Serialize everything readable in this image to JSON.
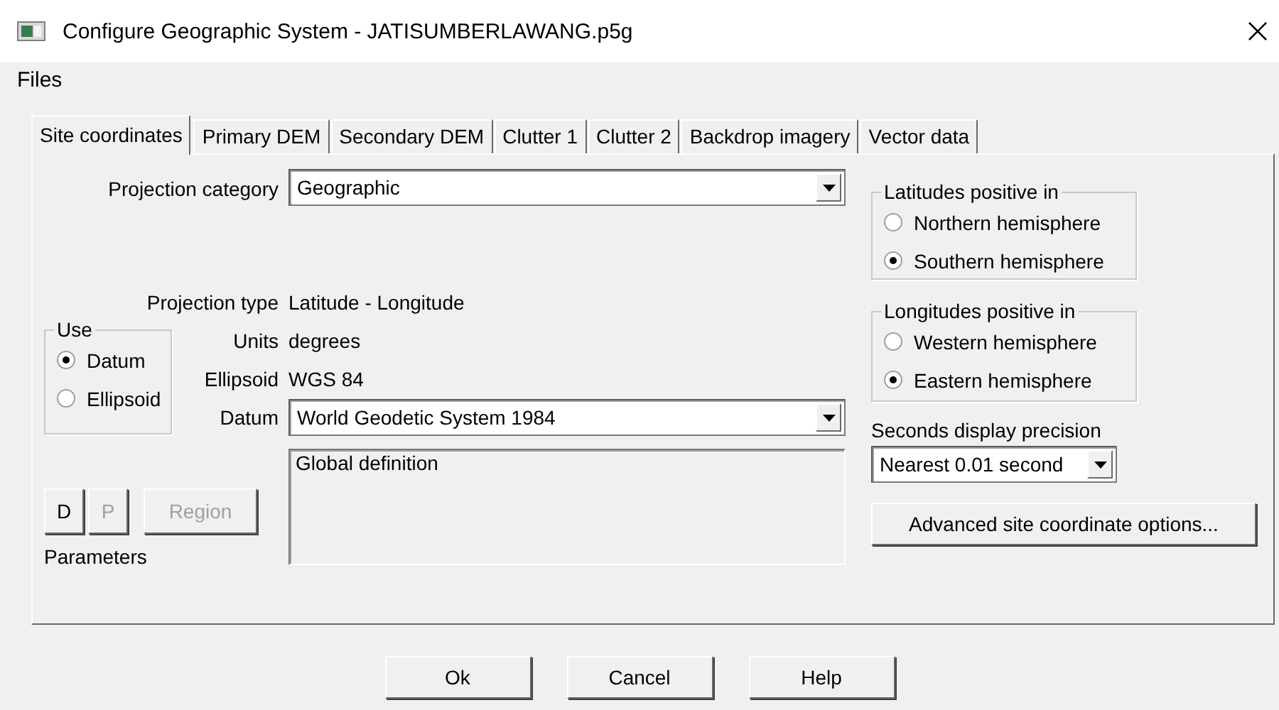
{
  "window": {
    "title": "Configure Geographic System - JATISUMBERLAWANG.p5g"
  },
  "menu": [
    "Files"
  ],
  "tabs": [
    {
      "label": "Site coordinates",
      "selected": true
    },
    {
      "label": "Primary DEM",
      "selected": false
    },
    {
      "label": "Secondary DEM",
      "selected": false
    },
    {
      "label": "Clutter 1",
      "selected": false
    },
    {
      "label": "Clutter 2",
      "selected": false
    },
    {
      "label": "Backdrop imagery",
      "selected": false
    },
    {
      "label": "Vector data",
      "selected": false
    }
  ],
  "site": {
    "projection_category": {
      "label": "Projection category",
      "value": "Geographic"
    },
    "info": [
      {
        "label": "Projection type",
        "value": "Latitude - Longitude"
      },
      {
        "label": "Units",
        "value": "degrees"
      },
      {
        "label": "Ellipsoid",
        "value": "WGS 84"
      }
    ],
    "use": {
      "title": "Use",
      "options": [
        {
          "label": "Datum",
          "selected": true
        },
        {
          "label": "Ellipsoid",
          "selected": false
        }
      ]
    },
    "datum": {
      "label": "Datum",
      "value": "World Geodetic System 1984"
    },
    "definition": "Global definition",
    "parameter_buttons": [
      {
        "label": "D",
        "disabled": false
      },
      {
        "label": "P",
        "disabled": true
      },
      {
        "label": "Region",
        "disabled": true
      }
    ],
    "parameters_label": "Parameters",
    "latitudes": {
      "title": "Latitudes positive in",
      "options": [
        {
          "label": "Northern hemisphere",
          "selected": false
        },
        {
          "label": "Southern hemisphere",
          "selected": true
        }
      ]
    },
    "longitudes": {
      "title": "Longitudes positive in",
      "options": [
        {
          "label": "Western hemisphere",
          "selected": false
        },
        {
          "label": "Eastern hemisphere",
          "selected": true
        }
      ]
    },
    "seconds_precision": {
      "label": "Seconds display precision",
      "value": "Nearest 0.01 second"
    },
    "advanced_button": "Advanced site coordinate options..."
  },
  "buttons": [
    "Ok",
    "Cancel",
    "Help"
  ]
}
